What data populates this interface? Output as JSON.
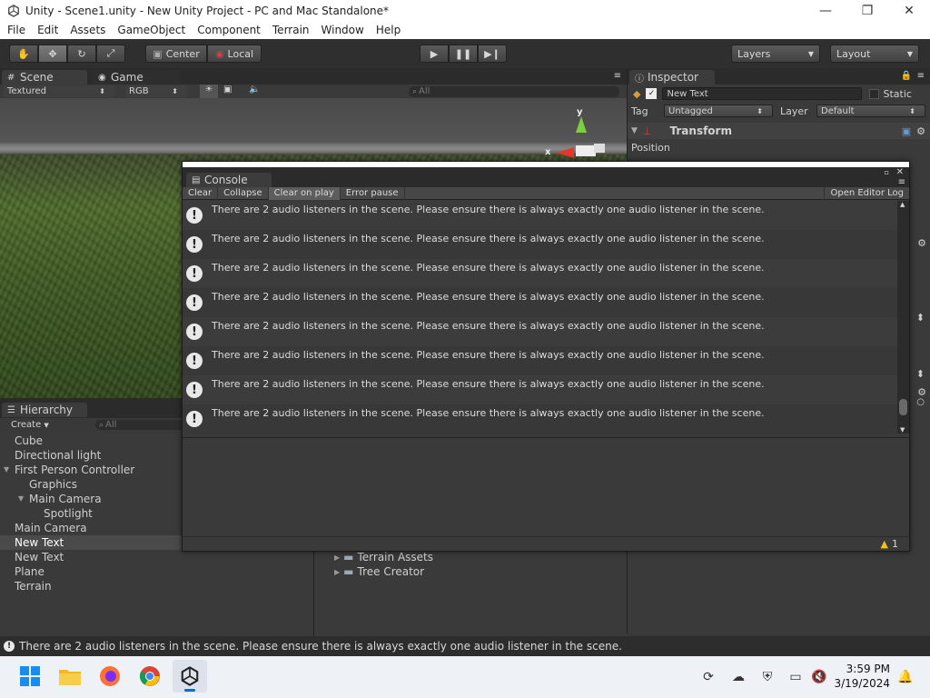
{
  "window": {
    "title": "Unity - Scene1.unity - New Unity Project - PC and Mac Standalone*",
    "minimize_glyph": "—",
    "restore_glyph": "❐",
    "close_glyph": "✕"
  },
  "menu": [
    "File",
    "Edit",
    "Assets",
    "GameObject",
    "Component",
    "Terrain",
    "Window",
    "Help"
  ],
  "toolbar": {
    "pivot_center": "Center",
    "pivot_local": "Local",
    "layers": "Layers",
    "layout": "Layout"
  },
  "scene_panel": {
    "scene_tab": "Scene",
    "game_tab": "Game",
    "render_mode": "Textured",
    "color_mode": "RGB",
    "search_placeholder": "All",
    "gizmo_y": "y",
    "gizmo_x": "x"
  },
  "inspector": {
    "tab": "Inspector",
    "object_name": "New Text",
    "static_label": "Static",
    "tag_label": "Tag",
    "tag_value": "Untagged",
    "layer_label": "Layer",
    "layer_value": "Default",
    "component_title": "Transform",
    "position_label": "Position"
  },
  "hierarchy": {
    "tab": "Hierarchy",
    "create_label": "Create",
    "search_placeholder": "All",
    "items": [
      {
        "label": "Cube",
        "depth": 0,
        "expander": ""
      },
      {
        "label": "Directional light",
        "depth": 0,
        "expander": ""
      },
      {
        "label": "First Person Controller",
        "depth": 0,
        "expander": "▼"
      },
      {
        "label": "Graphics",
        "depth": 1,
        "expander": ""
      },
      {
        "label": "Main Camera",
        "depth": 1,
        "expander": "▼"
      },
      {
        "label": "Spotlight",
        "depth": 2,
        "expander": ""
      },
      {
        "label": "Main Camera",
        "depth": 0,
        "expander": ""
      },
      {
        "label": "New Text",
        "depth": 0,
        "expander": "",
        "selected": true
      },
      {
        "label": "New Text",
        "depth": 0,
        "expander": ""
      },
      {
        "label": "Plane",
        "depth": 0,
        "expander": ""
      },
      {
        "label": "Terrain",
        "depth": 0,
        "expander": ""
      }
    ]
  },
  "project": {
    "folders": [
      "Terrain Assets",
      "Tree Creator"
    ]
  },
  "console": {
    "tab": "Console",
    "buttons": {
      "clear": "Clear",
      "collapse": "Collapse",
      "clear_on_play": "Clear on play",
      "error_pause": "Error pause",
      "open_editor_log": "Open Editor Log"
    },
    "entries": [
      "There are 2 audio listeners in the scene. Please ensure there is always exactly one audio listener in the scene.",
      "There are 2 audio listeners in the scene. Please ensure there is always exactly one audio listener in the scene.",
      "There are 2 audio listeners in the scene. Please ensure there is always exactly one audio listener in the scene.",
      "There are 2 audio listeners in the scene. Please ensure there is always exactly one audio listener in the scene.",
      "There are 2 audio listeners in the scene. Please ensure there is always exactly one audio listener in the scene.",
      "There are 2 audio listeners in the scene. Please ensure there is always exactly one audio listener in the scene.",
      "There are 2 audio listeners in the scene. Please ensure there is always exactly one audio listener in the scene.",
      "There are 2 audio listeners in the scene. Please ensure there is always exactly one audio listener in the scene."
    ],
    "warning_count": "1"
  },
  "status_bar": {
    "message": "There are 2 audio listeners in the scene. Please ensure there is always exactly one audio listener in the scene."
  },
  "taskbar": {
    "time": "3:59 PM",
    "date": "3/19/2024"
  },
  "colors": {
    "editor_bg": "#383838",
    "selection": "#4a4a4a",
    "warning_yellow": "#f0c020",
    "gizmo_y": "#7cd03a",
    "gizmo_x": "#e03a2a"
  }
}
